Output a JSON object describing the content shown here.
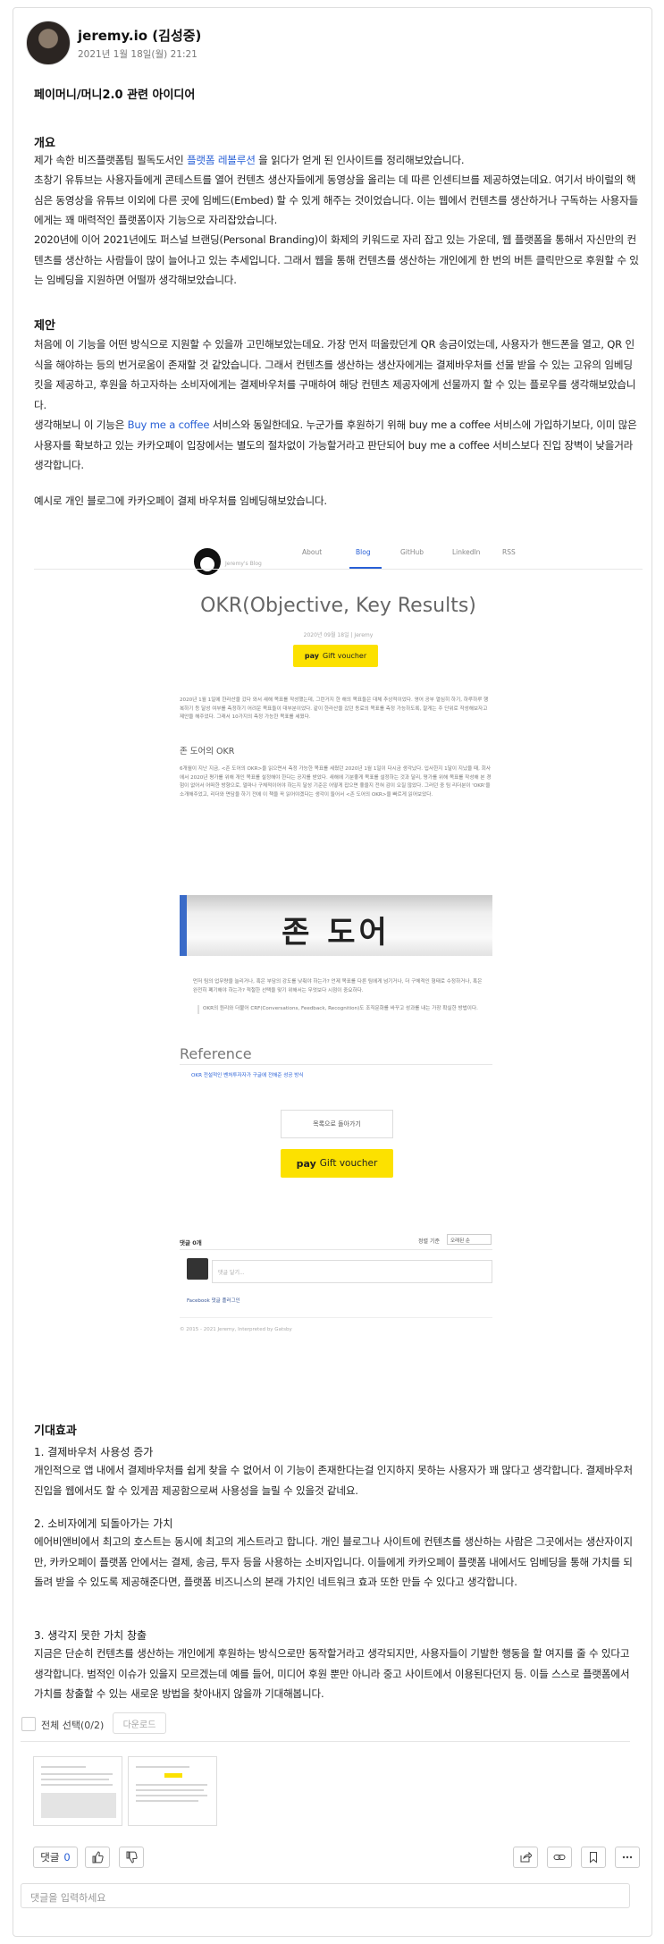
{
  "author": {
    "name": "jeremy.io (김성중)",
    "date": "2021년 1월 18일(월) 21:21"
  },
  "post": {
    "title": "페이머니/머니2.0 관련 아이디어",
    "overview": {
      "heading": "개요",
      "line1_pre": "제가 속한 비즈플랫폼팀 필독도서인 ",
      "line1_link": "플랫폼 레볼루션",
      "line1_post": " 을 읽다가 얻게 된 인사이트를 정리해보았습니다.",
      "para2": "초창기 유튜브는 사용자들에게 콘테스트를 열어 컨텐츠 생산자들에게 동영상을 올리는 데 따른 인센티브를 제공하였는데요. 여기서 바이럴의 핵심은 동영상을 유튜브 이외에 다른 곳에 임베드(Embed) 할 수 있게 해주는 것이었습니다. 이는 웹에서 컨텐츠를 생산하거나 구독하는 사용자들에게는 꽤 매력적인 플랫폼이자 기능으로 자리잡았습니다.",
      "para3": "2020년에 이어 2021년에도 퍼스널 브랜딩(Personal Branding)이 화제의 키워드로 자리 잡고 있는 가운데, 웹 플랫폼을 통해서 자신만의 컨텐츠를 생산하는 사람들이 많이 늘어나고 있는 추세입니다. 그래서 웹을 통해 컨텐츠를 생산하는 개인에게 한 번의 버튼 클릭만으로 후원할 수 있는 임베딩을 지원하면 어떨까 생각해보았습니다."
    },
    "proposal": {
      "heading": "제안",
      "para1": "처음에 이 기능을 어떤 방식으로 지원할 수 있을까 고민해보았는데요. 가장 먼저 떠올랐던게 QR 송금이었는데, 사용자가 핸드폰을 열고, QR 인식을 해야하는 등의 번거로움이 존재할 것 같았습니다. 그래서 컨텐츠를 생산하는 생산자에게는 결제바우처를 선물 받을 수 있는 고유의 임베딩 킷을 제공하고, 후원을 하고자하는 소비자에게는 결제바우처를 구매하여 해당 컨텐츠 제공자에게 선물까지 할 수 있는 플로우를 생각해보았습니다.",
      "para2_pre": "생각해보니 이 기능은 ",
      "para2_link": "Buy me a coffee",
      "para2_post": " 서비스와 동일한데요. 누군가를 후원하기 위해 buy me a coffee 서비스에 가입하기보다, 이미 많은 사용자를 확보하고 있는 카카오페이 입장에서는 별도의 절차없이 가능할거라고 판단되어 buy me a coffee 서비스보다 진입 장벽이 낮을거라 생각합니다.",
      "para3": "예시로 개인 블로그에 카카오페이 결제 바우처를 임베딩해보았습니다."
    },
    "effects": {
      "heading": "기대효과",
      "items": [
        {
          "title": "1. 결제바우처 사용성 증가",
          "body": "개인적으로 앱 내에서 결제바우처를 쉽게 찾을 수 없어서 이 기능이 존재한다는걸 인지하지 못하는 사용자가 꽤 많다고 생각합니다. 결제바우처 진입을 웹에서도 할 수 있게끔 제공함으로써 사용성을 늘릴 수 있을것 같네요."
        },
        {
          "title": "2. 소비자에게 되돌아가는 가치",
          "body": "에어비앤비에서 최고의 호스트는 동시에 최고의 게스트라고 합니다. 개인 블로그나 사이트에 컨텐츠를 생산하는 사람은 그곳에서는 생산자이지만, 카카오페이 플랫폼 안에서는 결제, 송금, 투자 등을 사용하는 소비자입니다. 이들에게 카카오페이 플랫폼 내에서도 임베딩을 통해 가치를 되돌려 받을 수 있도록 제공해준다면, 플랫폼 비즈니스의 본래 가치인 네트워크 효과 또한 만들 수 있다고 생각합니다."
        },
        {
          "title": "3. 생각지 못한 가치 창출",
          "body": "지금은 단순히 컨텐츠를 생산하는 개인에게 후원하는 방식으로만 동작할거라고 생각되지만, 사용자들이 기발한 행동을 할 여지를 줄 수 있다고 생각합니다. 범적인 이슈가 있을지 모르겠는데 예를 들어, 미디어 후원 뿐만 아니라 중고 사이트에서 이용된다던지 등. 이들 스스로 플랫폼에서 가치를 창출할 수 있는 새로운 방법을 찾아내지 않을까 기대해봅니다."
        }
      ]
    }
  },
  "embedded_blog": {
    "blog_name": "Jeremy's Blog",
    "nav": [
      "About",
      "Blog",
      "GitHub",
      "LinkedIn",
      "RSS"
    ],
    "title": "OKR(Objective, Key Results)",
    "subtitle": "2020년 09월 18일  |  Jeremy",
    "pay_label": "pay",
    "gift_label": "Gift voucher",
    "intro": "2020년 1월 1일에 한라산을 갔다 와서 새해 목표를 작성했는데, 그런거지 한 해의 목표들은 대체 추상적이었다. 영어 공부 열심히 하기, 하루하루 행복하기 등 달성 여부를 측정하기 어려운 목표들이 대부분이었다. 같이 한라산을 갔던 동료의 목표를 측정 가능하도록, 잘게는 주 단위로 작성해보자고 제안을 해주었다. 그래서 10가지의 측정 가능한 목표를 세웠다.",
    "section": "존 도어의 OKR",
    "body": "6개월이 지난 지금, <존 도어의 OKR>을 읽으면서 측정 가능한 목표를 세웠던 2020년 1월 1일이 다시금 생각났다. 입사한지 1달이 지났을 때, 회사에서 2020년 평가를 위해 개인 목표를 설정해야 한다는 공지를 받았다. 새해에 기분좋게 목표를 설정하는 것과 달리, 평가를 위해 목표를 작성해 본 경험이 없어서 어떠한 방향으로, 얼마나 구체적이어야 하는지 달성 기준은 어떻게 잡으면 좋을지 전혀 감이 오질 않았다. 그러던 중 팀 리더분이 'OKR'을 소개해주었고, 리더와 면담을 하기 전에 이 책을 꼭 읽어야겠다는 생각이 들어서 <존 도어의 OKR>을 빠르게 읽어보았다.",
    "photo_text": "존 도어",
    "bullet1": "먼저 팀의 업무량을 늘리거나, 혹은 부담의 강도를 낮춰야 하는가? 언제 목표를 다른 팀에게 넘기거나, 더 구체적인 형태로 수정하거나, 혹은 완전히 폐기해야 하는가? 적절한 선택을 맞기 위해서는 무엇보다 시점이 중요하다.",
    "bullet2": "OKR의 원리와 더불어 CRF(Conversations, Feedback, Recognition)도 조직문화를 바꾸고 성과를 내는 가장 확실한 방법이다.",
    "reference_heading": "Reference",
    "reference_link": "OKR 전설적인 벤처투자자가 구글에 전해준 성공 방식",
    "back_button": "목록으로 돌아가기",
    "comments_count": "댓글 0개",
    "sort_label": "정렬 기준",
    "sort_value": "오래된 순",
    "comment_placeholder": "댓글 달기...",
    "facebook_plugin": "Facebook 댓글 플러그인",
    "footer": "© 2015 - 2021 Jeremy, Interpreted by Gatsby"
  },
  "attachments": {
    "select_all": "전체 선택(0/2)",
    "download": "다운로드"
  },
  "actions": {
    "comment_label": "댓글",
    "comment_count": "0",
    "icons": [
      "like-icon",
      "dislike-icon",
      "share-icon",
      "link-icon",
      "bookmark-icon",
      "more-icon"
    ]
  },
  "comment_input": {
    "placeholder": "댓글을 입력하세요"
  },
  "colors": {
    "link": "#2960d6",
    "kakao_yellow": "#fce100"
  }
}
